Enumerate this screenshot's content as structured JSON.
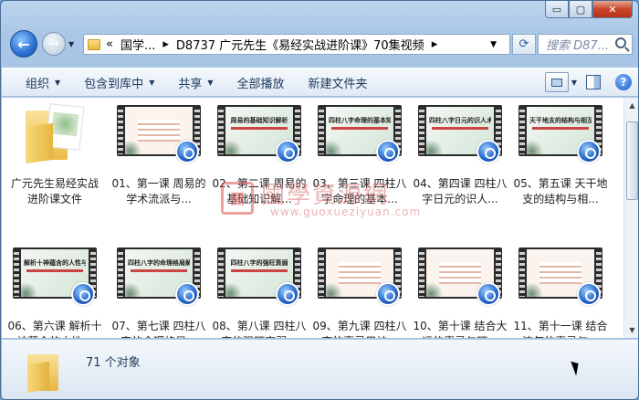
{
  "window": {
    "caption": {
      "minimize": "▭",
      "maximize": "▢",
      "close": "✕"
    }
  },
  "address": {
    "overflow": "«",
    "crumbs": [
      "国学...",
      "D8737 广元先生《易经实战进阶课》70集视频"
    ]
  },
  "search": {
    "placeholder": "搜索 D87..."
  },
  "toolbar": {
    "organize": "组织",
    "include_library": "包含到库中",
    "share": "共享",
    "play_all": "全部播放",
    "new_folder": "新建文件夹"
  },
  "items": [
    {
      "label": "广元先生易经实战进阶课文件",
      "kind": "folder"
    },
    {
      "label": "01、第一课 周易的学术流派与...",
      "kind": "video",
      "slide": "list"
    },
    {
      "label": "02、第二课 周易的基础知识解...",
      "kind": "video",
      "slide": "周易的基础知识解析"
    },
    {
      "label": "03、第三课 四柱八字命理的基本...",
      "kind": "video",
      "slide": "四柱八字命理的基本知识"
    },
    {
      "label": "04、第四课 四柱八字日元的识人...",
      "kind": "video",
      "slide": "四柱八字日元的识人术"
    },
    {
      "label": "05、第五课 天干地支的结构与相...",
      "kind": "video",
      "slide": "天干地支的结构与相互作用"
    },
    {
      "label": "06、第六课 解析十神蕴含的人性...",
      "kind": "video",
      "slide": "解析十神蕴含的人性与关系"
    },
    {
      "label": "07、第七课 四柱八字的命理格局...",
      "kind": "video",
      "slide": "四柱八字的命理格局解析"
    },
    {
      "label": "08、第八课 四柱八字的强旺衰弱...",
      "kind": "video",
      "slide": "四柱八字的强旺衰弱"
    },
    {
      "label": "09、第九课 四柱八字的喜忌用神...",
      "kind": "video",
      "slide": "list"
    },
    {
      "label": "10、第十课 结合大运的喜忌与旺...",
      "kind": "video",
      "slide": "list"
    },
    {
      "label": "11、第十一课 结合流年的喜忌与...",
      "kind": "video",
      "slide": "list"
    }
  ],
  "watermark": {
    "seal": "國",
    "cn": "國學資源網",
    "en": "www.guoxueziyuan.com"
  },
  "status": {
    "count": "71 个对象"
  }
}
